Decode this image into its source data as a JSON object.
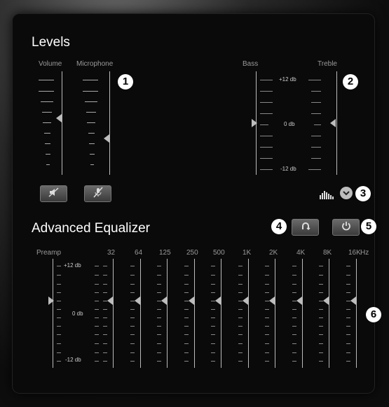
{
  "levels": {
    "title": "Levels",
    "volume_label": "Volume",
    "microphone_label": "Microphone",
    "bass_label": "Bass",
    "treble_label": "Treble",
    "plus_db": "+12 db",
    "zero_db": "0 db",
    "minus_db": "-12 db",
    "volume_level": 0.55,
    "microphone_level": 0.35,
    "bass_level": 0.5,
    "treble_level": 0.5
  },
  "equalizer": {
    "title": "Advanced Equalizer",
    "preamp_label": "Preamp",
    "hz_label": "Hz",
    "plus_db": "+12 db",
    "zero_db": "0 db",
    "minus_db": "-12 db",
    "bands": [
      "32",
      "64",
      "125",
      "250",
      "500",
      "1K",
      "2K",
      "4K",
      "8K",
      "16K"
    ]
  },
  "callouts": [
    "1",
    "2",
    "3",
    "4",
    "5",
    "6"
  ],
  "icons": {
    "mute_volume": "speaker-muted-icon",
    "mute_mic": "microphone-muted-icon",
    "eq_presets": "equalizer-bars-icon",
    "dropdown": "chevron-down-icon",
    "reset": "reset-icon",
    "power": "power-icon"
  }
}
